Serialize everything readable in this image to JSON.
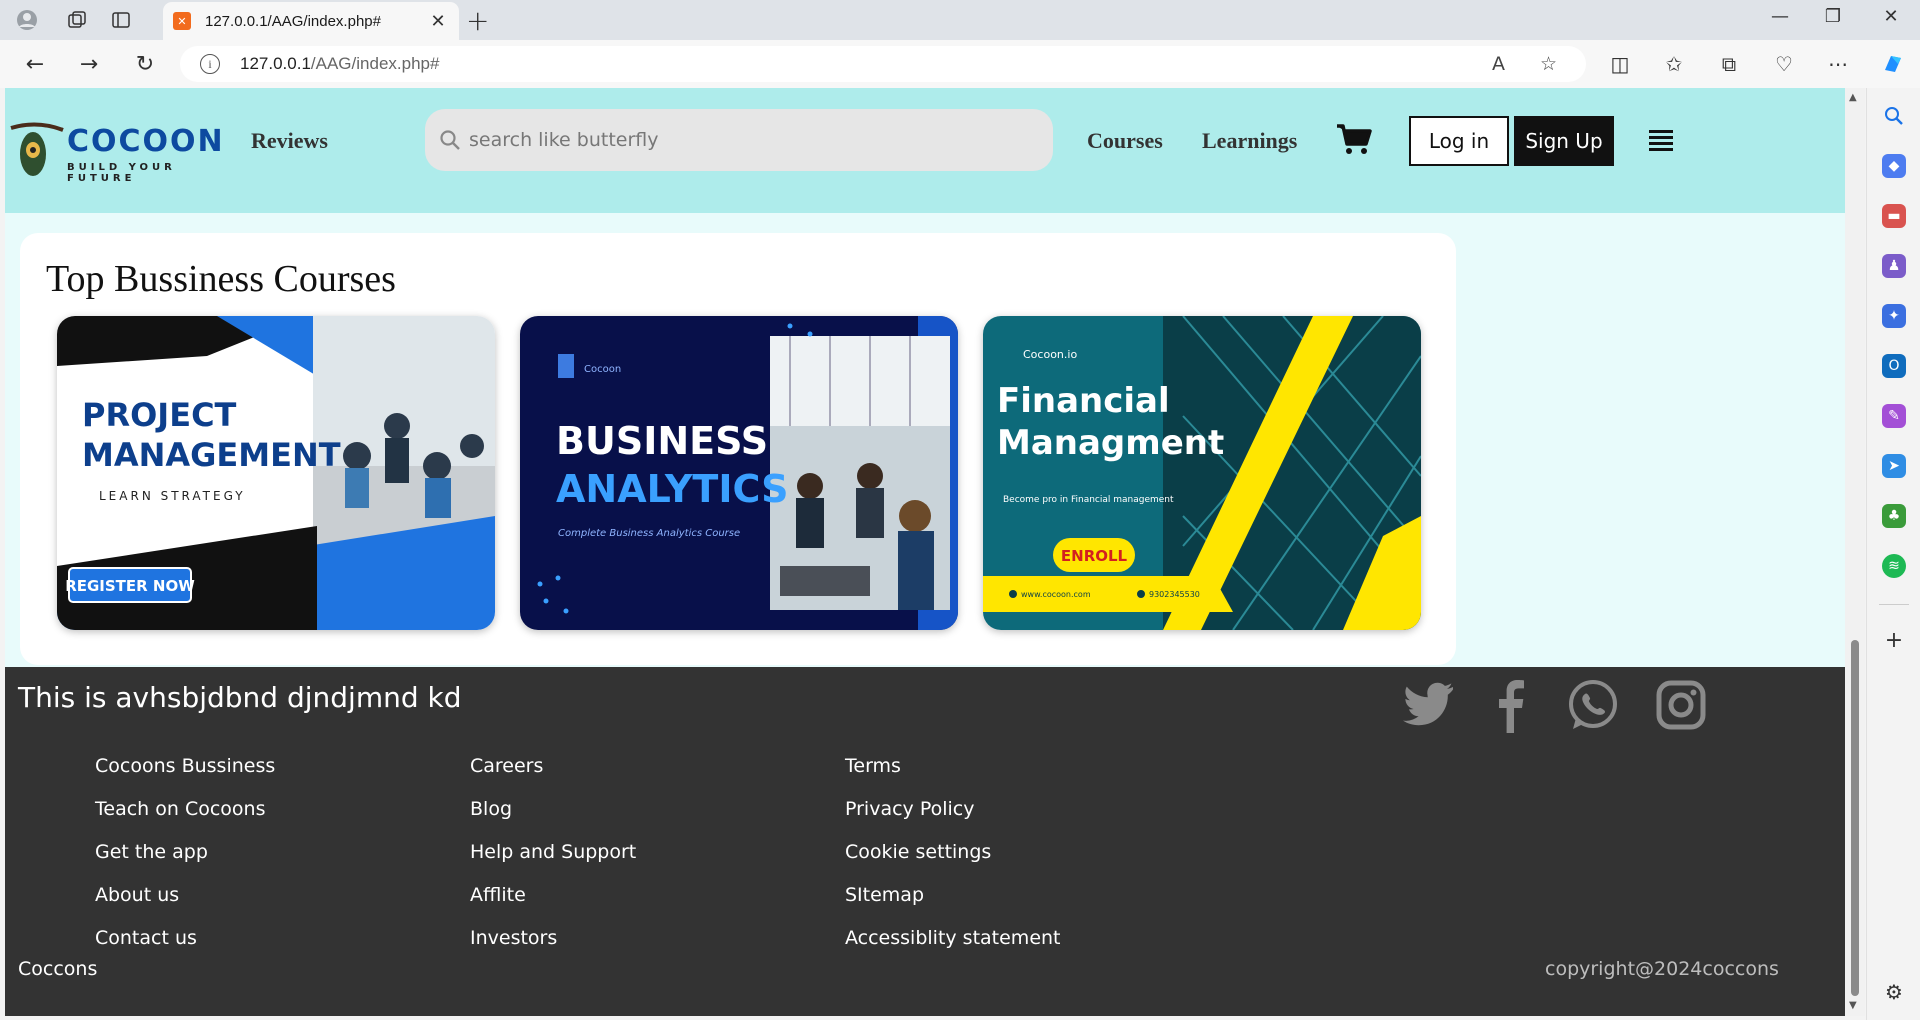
{
  "browser": {
    "tab_title": "127.0.0.1/AAG/index.php#",
    "url_host": "127.0.0.1",
    "url_path": "/AAG/index.php#"
  },
  "header": {
    "logo_brand": "COCOON",
    "logo_tagline": "BUILD YOUR FUTURE",
    "reviews": "Reviews",
    "search_placeholder": "search like butterfly",
    "courses": "Courses",
    "learnings": "Learnings",
    "login": "Log in",
    "signup": "Sign Up"
  },
  "courses_section": {
    "title": "Top Bussiness Courses",
    "cards": [
      {
        "line1": "PROJECT",
        "line2": "MANAGEMENT",
        "sub": "LEARN STRATEGY",
        "cta": "REGISTER NOW"
      },
      {
        "brand": "Cocoon",
        "line1": "BUSINESS",
        "line2": "ANALYTICS",
        "sub": "Complete Business Analytics Course"
      },
      {
        "brand": "Cocoon.io",
        "line1": "Financial",
        "line2": "Managment",
        "sub": "Become pro in Financial management",
        "cta": "ENROLL",
        "web": "www.cocoon.com",
        "phone": "9302345530"
      }
    ]
  },
  "footer": {
    "title": "This is avhsbjdbnd djndjmnd kd",
    "col1": [
      "Cocoons Bussiness",
      "Teach on Cocoons",
      "Get the app",
      "About us",
      "Contact us"
    ],
    "col2": [
      "Careers",
      "Blog",
      "Help and Support",
      "Afflite",
      "Investors"
    ],
    "col3": [
      "Terms",
      "Privacy Policy",
      "Cookie settings",
      "SItemap",
      "Accessiblity statement"
    ],
    "brand": "Coccons",
    "copyright": "copyright@2024coccons",
    "social_icons": [
      "twitter-icon",
      "facebook-icon",
      "whatsapp-icon",
      "instagram-icon"
    ]
  },
  "colors": {
    "header_bg": "#aeeceb",
    "page_bg": "#e8fbfb",
    "footer_bg": "#333333",
    "brand_blue": "#0d4aa0"
  }
}
